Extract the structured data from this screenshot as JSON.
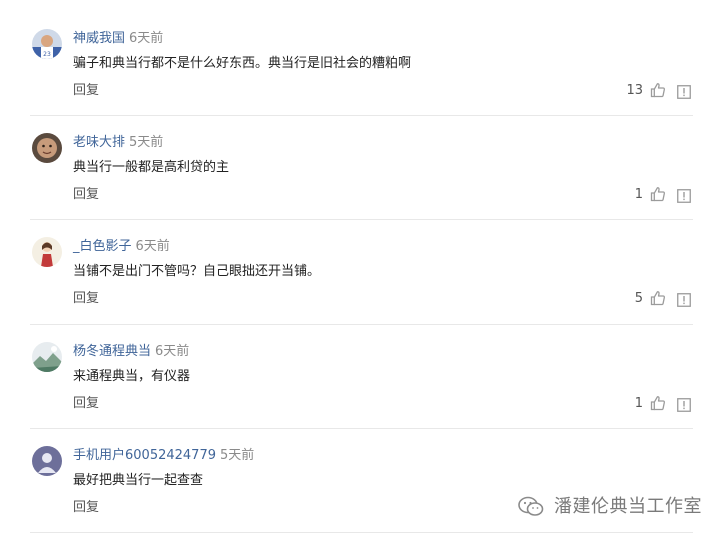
{
  "comments": [
    {
      "username": "神威我国",
      "time": "6天前",
      "text": "骗子和典当行都不是什么好东西。典当行是旧社会的糟粕啊",
      "reply_label": "回复",
      "likes": "13",
      "avatar_icon": "basketball-player-avatar"
    },
    {
      "username": "老味大排",
      "time": "5天前",
      "text": "典当行一般都是高利贷的主",
      "reply_label": "回复",
      "likes": "1",
      "avatar_icon": "face-avatar"
    },
    {
      "username": "_白色影子",
      "time": "6天前",
      "text": "当铺不是出门不管吗？自己眼拙还开当铺。",
      "reply_label": "回复",
      "likes": "5",
      "avatar_icon": "girl-cartoon-avatar"
    },
    {
      "username": "杨冬通程典当",
      "time": "6天前",
      "text": "来通程典当，有仪器",
      "reply_label": "回复",
      "likes": "1",
      "avatar_icon": "landscape-avatar"
    },
    {
      "username": "手机用户60052424779",
      "time": "5天前",
      "text": "最好把典当行一起查查",
      "reply_label": "回复",
      "likes": "",
      "avatar_icon": "default-user-avatar"
    }
  ],
  "watermark": {
    "text": "潘建伦典当工作室",
    "icon": "wechat-icon"
  },
  "colors": {
    "username": "#406599",
    "time": "#8a8a8a",
    "text": "#222222",
    "icon": "#9b9b9b"
  }
}
